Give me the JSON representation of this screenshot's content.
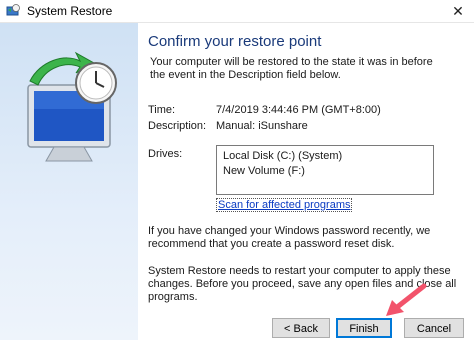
{
  "window": {
    "title": "System Restore",
    "close_glyph": "✕"
  },
  "main": {
    "heading": "Confirm your restore point",
    "intro": "Your computer will be restored to the state it was in before the event in the Description field below.",
    "time_label": "Time:",
    "time_value": "7/4/2019 3:44:46 PM (GMT+8:00)",
    "description_label": "Description:",
    "description_value": "Manual: iSunshare",
    "drives_label": "Drives:",
    "drives": [
      "Local Disk (C:) (System)",
      "New Volume (F:)"
    ],
    "scan_link": "Scan for affected programs",
    "password_note": "If you have changed your Windows password recently, we recommend that you create a password reset disk.",
    "restart_note": "System Restore needs to restart your computer to apply these changes. Before you proceed, save any open files and close all programs."
  },
  "buttons": {
    "back": "< Back",
    "finish": "Finish",
    "cancel": "Cancel"
  },
  "colors": {
    "accent": "#0078d7",
    "heading": "#1a3a7a",
    "link": "#0a3bc2",
    "arrow": "#f2536b"
  }
}
